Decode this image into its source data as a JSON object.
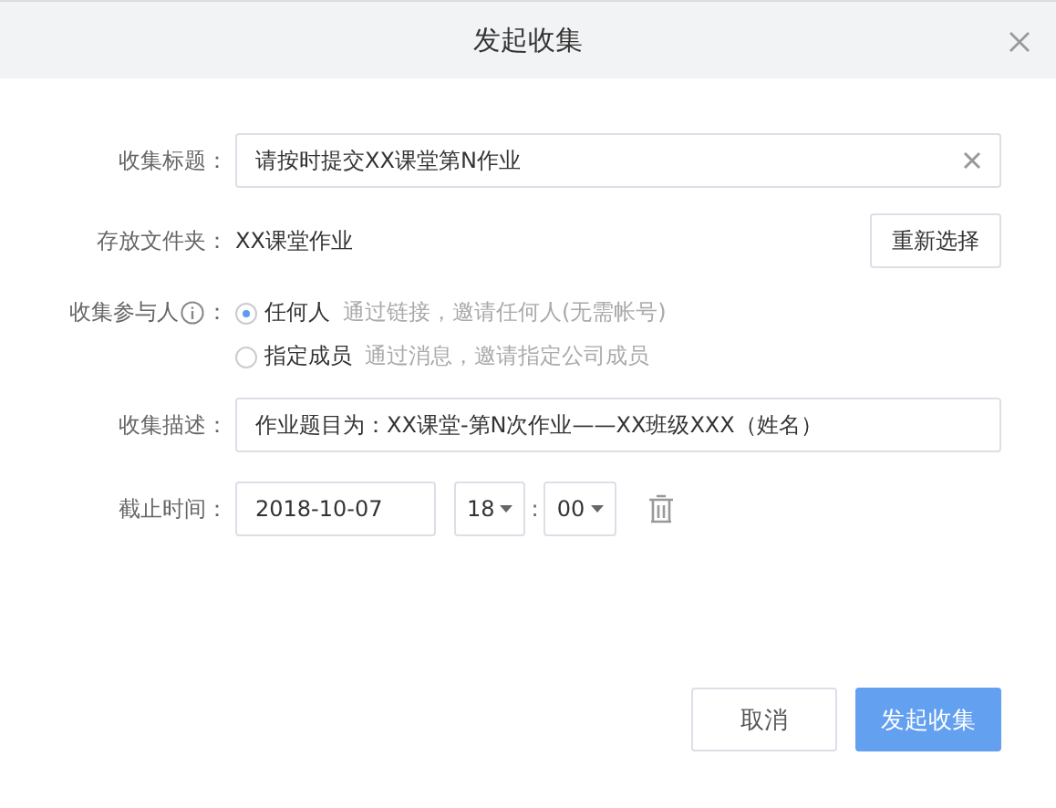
{
  "dialog": {
    "title": "发起收集"
  },
  "title_field": {
    "label": "收集标题：",
    "value": "请按时提交XX课堂第N作业"
  },
  "folder": {
    "label": "存放文件夹：",
    "value": "XX课堂作业",
    "button": "重新选择"
  },
  "participants": {
    "label": "收集参与人",
    "colon": "：",
    "options": [
      {
        "label": "任何人",
        "hint": "通过链接，邀请任何人(无需帐号)",
        "selected": true
      },
      {
        "label": "指定成员",
        "hint": "通过消息，邀请指定公司成员",
        "selected": false
      }
    ]
  },
  "description": {
    "label": "收集描述：",
    "value": "作业题目为：XX课堂-第N次作业——XX班级XXX（姓名）"
  },
  "deadline": {
    "label": "截止时间：",
    "date": "2018-10-07",
    "hour": "18",
    "separator": ":",
    "minute": "00"
  },
  "buttons": [
    {
      "label": "取消",
      "kind": "secondary"
    },
    {
      "label": "发起收集",
      "kind": "primary"
    }
  ]
}
